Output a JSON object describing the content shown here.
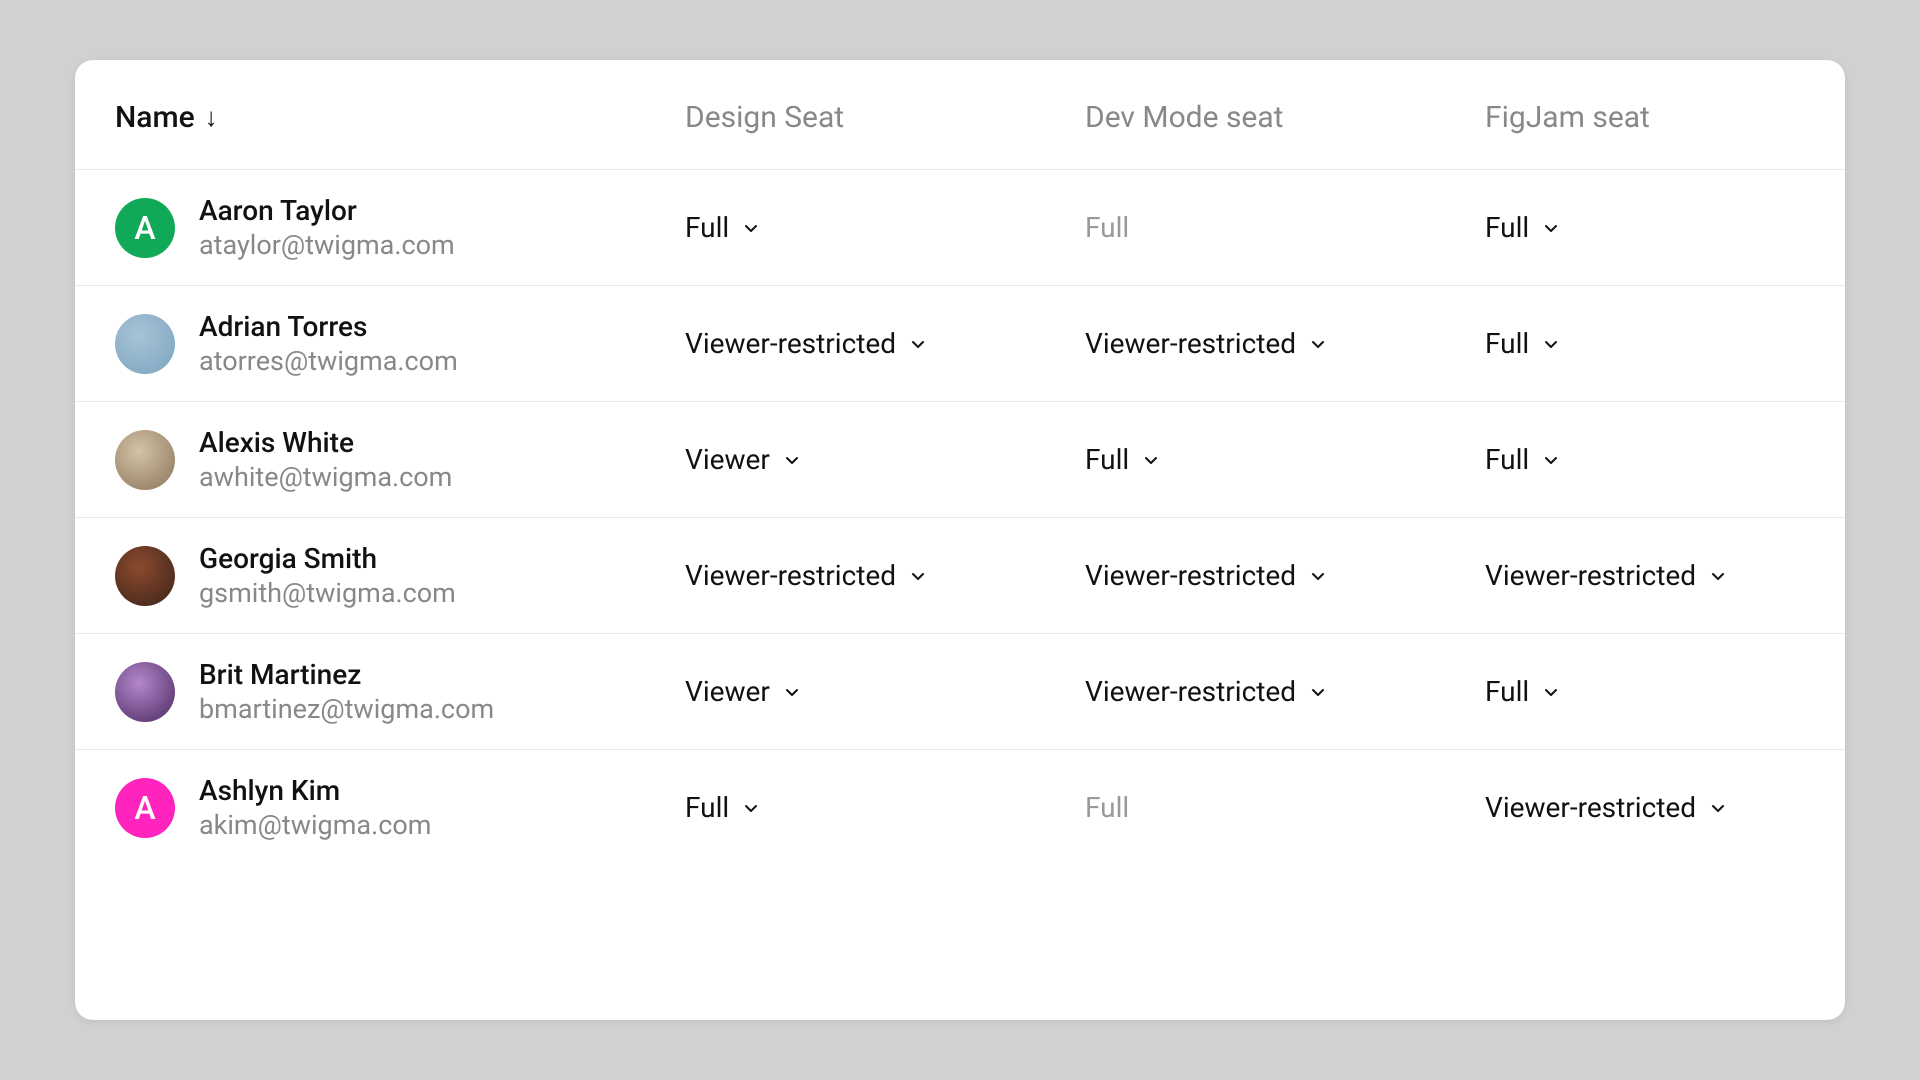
{
  "columns": {
    "name": "Name",
    "design": "Design Seat",
    "devmode": "Dev Mode seat",
    "figjam": "FigJam seat"
  },
  "sort_indicator": "↓",
  "users": [
    {
      "name": "Aaron Taylor",
      "email": "ataylor@twigma.com",
      "avatar_type": "initial",
      "initial": "A",
      "avatar_bg": "#0fa958",
      "design": {
        "value": "Full",
        "editable": true
      },
      "devmode": {
        "value": "Full",
        "editable": false
      },
      "figjam": {
        "value": "Full",
        "editable": true
      }
    },
    {
      "name": "Adrian Torres",
      "email": "atorres@twigma.com",
      "avatar_type": "photo",
      "avatar_bg": "#a8c4d6",
      "avatar_bg2": "#7aa3bf",
      "design": {
        "value": "Viewer-restricted",
        "editable": true
      },
      "devmode": {
        "value": "Viewer-restricted",
        "editable": true
      },
      "figjam": {
        "value": "Full",
        "editable": true
      }
    },
    {
      "name": "Alexis White",
      "email": "awhite@twigma.com",
      "avatar_type": "photo",
      "avatar_bg": "#d4c3a8",
      "avatar_bg2": "#8a7458",
      "design": {
        "value": "Viewer",
        "editable": true
      },
      "devmode": {
        "value": "Full",
        "editable": true
      },
      "figjam": {
        "value": "Full",
        "editable": true
      }
    },
    {
      "name": "Georgia Smith",
      "email": "gsmith@twigma.com",
      "avatar_type": "photo",
      "avatar_bg": "#8c4a2e",
      "avatar_bg2": "#3a2318",
      "design": {
        "value": "Viewer-restricted",
        "editable": true
      },
      "devmode": {
        "value": "Viewer-restricted",
        "editable": true
      },
      "figjam": {
        "value": "Viewer-restricted",
        "editable": true
      }
    },
    {
      "name": "Brit Martinez",
      "email": "bmartinez@twigma.com",
      "avatar_type": "photo",
      "avatar_bg": "#b488cc",
      "avatar_bg2": "#4a2860",
      "design": {
        "value": "Viewer",
        "editable": true
      },
      "devmode": {
        "value": "Viewer-restricted",
        "editable": true
      },
      "figjam": {
        "value": "Full",
        "editable": true
      }
    },
    {
      "name": "Ashlyn Kim",
      "email": "akim@twigma.com",
      "avatar_type": "initial",
      "initial": "A",
      "avatar_bg": "#ff24bd",
      "design": {
        "value": "Full",
        "editable": true
      },
      "devmode": {
        "value": "Full",
        "editable": false
      },
      "figjam": {
        "value": "Viewer-restricted",
        "editable": true
      }
    }
  ]
}
